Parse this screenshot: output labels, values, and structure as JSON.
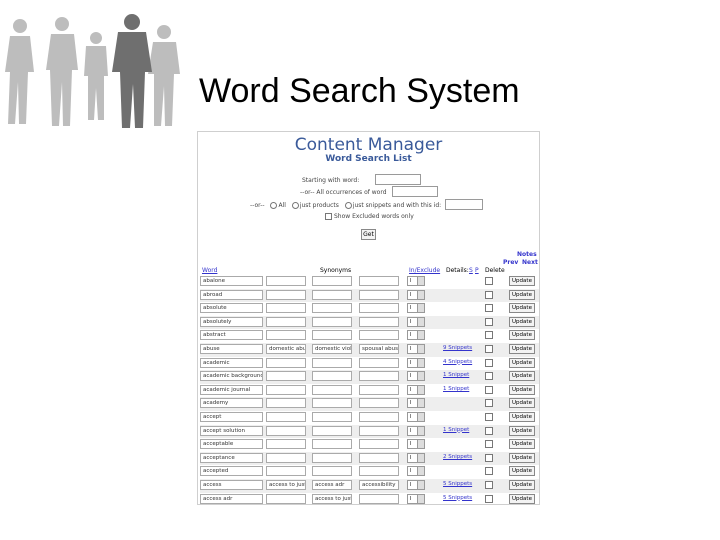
{
  "slide": {
    "title": "Word Search System"
  },
  "screenshot": {
    "header": "Content Manager",
    "subheader": "Word Search List",
    "form": {
      "starting_label": "Starting with word:",
      "all_label": "--or-- All occurrences of word",
      "or_label": "--or--",
      "radio_all": "All",
      "radio_products": "just products",
      "radio_snippets": "just snippets and with this id:",
      "checkbox_label": "Show Excluded words only",
      "get_button": "Get"
    },
    "right_links": {
      "notes": "Notes",
      "prev": "Prev",
      "next": "Next"
    },
    "columns": {
      "word": "Word",
      "synonyms": "Synonyms",
      "inexclude": "In/Exclude",
      "details": "Details:",
      "s": "S",
      "p": "P",
      "delete": "Delete"
    },
    "rows": [
      {
        "word": "abalone",
        "s1": "",
        "s2": "",
        "s3": "",
        "sel": "I",
        "details": ""
      },
      {
        "word": "abroad",
        "s1": "",
        "s2": "",
        "s3": "",
        "sel": "I",
        "details": ""
      },
      {
        "word": "absolute",
        "s1": "",
        "s2": "",
        "s3": "",
        "sel": "I",
        "details": ""
      },
      {
        "word": "absolutely",
        "s1": "",
        "s2": "",
        "s3": "",
        "sel": "I",
        "details": ""
      },
      {
        "word": "abstract",
        "s1": "",
        "s2": "",
        "s3": "",
        "sel": "I",
        "details": ""
      },
      {
        "word": "abuse",
        "s1": "domestic abuse",
        "s2": "domestic viole",
        "s3": "spousal abuse",
        "sel": "I",
        "details": "9 Snippets"
      },
      {
        "word": "academic",
        "s1": "",
        "s2": "",
        "s3": "",
        "sel": "I",
        "details": "4 Snippets"
      },
      {
        "word": "academic background",
        "s1": "",
        "s2": "",
        "s3": "",
        "sel": "I",
        "details": "1 Snippet"
      },
      {
        "word": "academic journal",
        "s1": "",
        "s2": "",
        "s3": "",
        "sel": "I",
        "details": "1 Snippet"
      },
      {
        "word": "academy",
        "s1": "",
        "s2": "",
        "s3": "",
        "sel": "I",
        "details": ""
      },
      {
        "word": "accept",
        "s1": "",
        "s2": "",
        "s3": "",
        "sel": "I",
        "details": ""
      },
      {
        "word": "accept solution",
        "s1": "",
        "s2": "",
        "s3": "",
        "sel": "I",
        "details": "1 Snippet"
      },
      {
        "word": "acceptable",
        "s1": "",
        "s2": "",
        "s3": "",
        "sel": "I",
        "details": ""
      },
      {
        "word": "acceptance",
        "s1": "",
        "s2": "",
        "s3": "",
        "sel": "I",
        "details": "2 Snippets"
      },
      {
        "word": "accepted",
        "s1": "",
        "s2": "",
        "s3": "",
        "sel": "I",
        "details": ""
      },
      {
        "word": "access",
        "s1": "access to justi",
        "s2": "access adr",
        "s3": "accessibility",
        "sel": "I",
        "details": "5 Snippets"
      },
      {
        "word": "access adr",
        "s1": "",
        "s2": "access to just",
        "s3": "",
        "sel": "I",
        "details": "5 Snippets"
      }
    ],
    "update_label": "Update"
  },
  "colors": {
    "header_blue": "#3a5a9a",
    "link": "#3333cc",
    "row_alt": "#eeeeee",
    "silhouette_light": "#bdbdbd",
    "silhouette_dark": "#6f6f6f"
  }
}
